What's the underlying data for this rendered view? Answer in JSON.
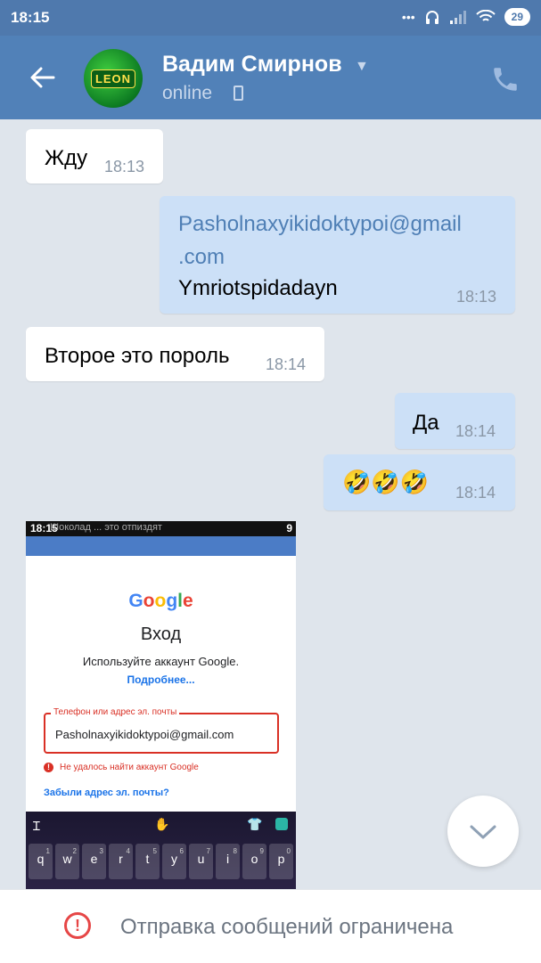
{
  "status_bar": {
    "time": "18:15",
    "icons": [
      "dots-icon",
      "headphones-icon",
      "signal-icon",
      "wifi-icon"
    ],
    "battery": "29"
  },
  "header": {
    "contact_name": "Вадим Смирнов",
    "status": "online",
    "avatar_text": "LEON"
  },
  "messages": [
    {
      "direction": "incoming",
      "text": "Жду",
      "time": "18:13"
    },
    {
      "direction": "outgoing",
      "lines": [
        "Pasholnaxyikidoktypoi@gmail",
        ".com",
        "Ymriotspidadayn"
      ],
      "time": "18:13"
    },
    {
      "direction": "incoming",
      "text": "Второе это пороль",
      "time": "18:14"
    },
    {
      "direction": "outgoing",
      "text": "Да",
      "time": "18:14"
    },
    {
      "direction": "outgoing",
      "text": "🤣🤣🤣",
      "time": "18:14"
    }
  ],
  "attachment": {
    "status_time": "18:15",
    "status_notice": "Шоколад ... это отпиздят",
    "status_right": "9",
    "google_logo": "Google",
    "title": "Вход",
    "subtitle": "Используйте аккаунт Google.",
    "more_link": "Подробнее...",
    "field_label": "Телефон или адрес эл. почты",
    "field_value": "Pasholnaxyikidoktypoi@gmail.com",
    "error_text": "Не удалось найти аккаунт Google",
    "forgot_link": "Забыли адрес эл. почты?",
    "keyboard_keys": [
      "q",
      "w",
      "e",
      "r",
      "t",
      "y",
      "u",
      "i",
      "o",
      "p"
    ],
    "keyboard_hints": [
      "1",
      "2",
      "3",
      "4",
      "5",
      "6",
      "7",
      "8",
      "9",
      "0"
    ]
  },
  "footer": {
    "text": "Отправка сообщений ограничена"
  },
  "colors": {
    "header_bg": "#5181b8",
    "status_bar_bg": "#4f79ad",
    "chat_bg": "#dfe5ec",
    "incoming_bubble": "#ffffff",
    "outgoing_bubble": "#cce0f7",
    "link": "#4f7fb5",
    "error": "#e64646"
  }
}
